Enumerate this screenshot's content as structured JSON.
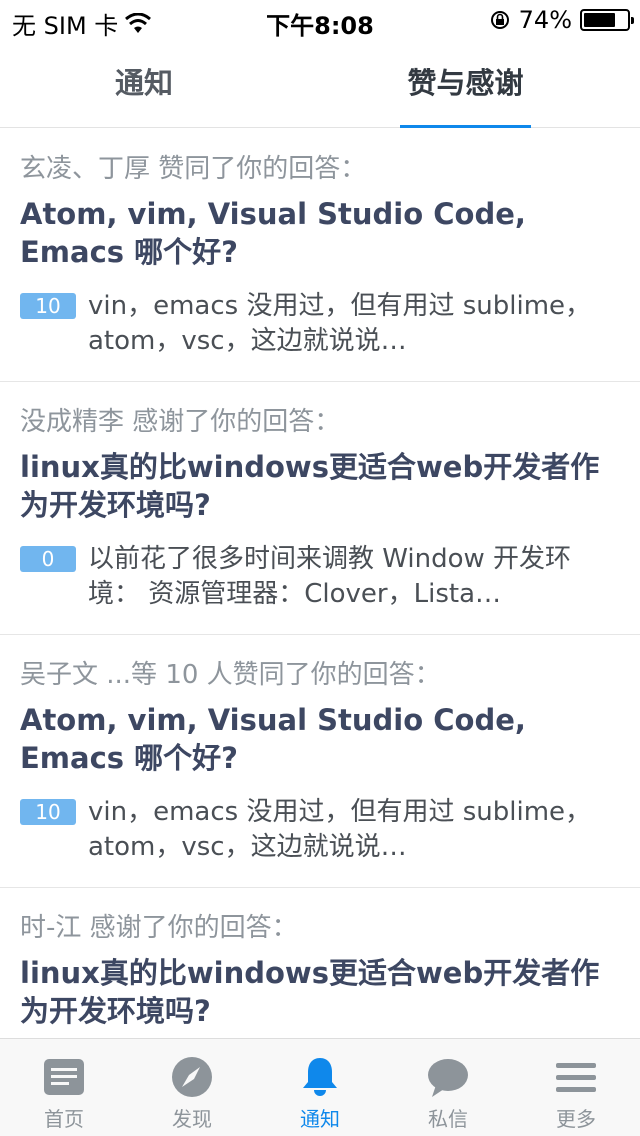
{
  "status_bar": {
    "carrier": "无 SIM 卡",
    "time": "下午8:08",
    "battery_percent": "74%",
    "battery_level": 0.74
  },
  "tabs": [
    {
      "label": "通知",
      "selected": false
    },
    {
      "label": "赞与感谢",
      "selected": true
    }
  ],
  "feed": [
    {
      "meta": "玄凌、丁厚 赞同了你的回答：",
      "title": "Atom, vim, Visual Studio Code, Emacs 哪个好?",
      "votes": "10",
      "excerpt": "vin，emacs 没用过，但有用过 sublime，atom，vsc，这边就说说…"
    },
    {
      "meta": "没成精李 感谢了你的回答：",
      "title": "linux真的比windows更适合web开发者作为开发环境吗?",
      "votes": "0",
      "excerpt": "以前花了很多时间来调教 Window 开发环境： 资源管理器：Clover，Lista…"
    },
    {
      "meta": "吴子文 ...等 10 人赞同了你的回答：",
      "title": "Atom, vim, Visual Studio Code, Emacs 哪个好?",
      "votes": "10",
      "excerpt": "vin，emacs 没用过，但有用过 sublime，atom，vsc，这边就说说…"
    },
    {
      "meta": "时-江 感谢了你的回答：",
      "title": "linux真的比windows更适合web开发者作为开发环境吗?"
    }
  ],
  "tabbar": [
    {
      "label": "首页",
      "icon": "home-icon"
    },
    {
      "label": "发现",
      "icon": "compass-icon"
    },
    {
      "label": "通知",
      "icon": "bell-icon",
      "active": true
    },
    {
      "label": "私信",
      "icon": "chat-bubble-icon"
    },
    {
      "label": "更多",
      "icon": "menu-icon"
    }
  ],
  "colors": {
    "accent": "#0f88eb",
    "title": "#3d4762",
    "meta": "#8e959c",
    "badge": "#71b6ef"
  }
}
